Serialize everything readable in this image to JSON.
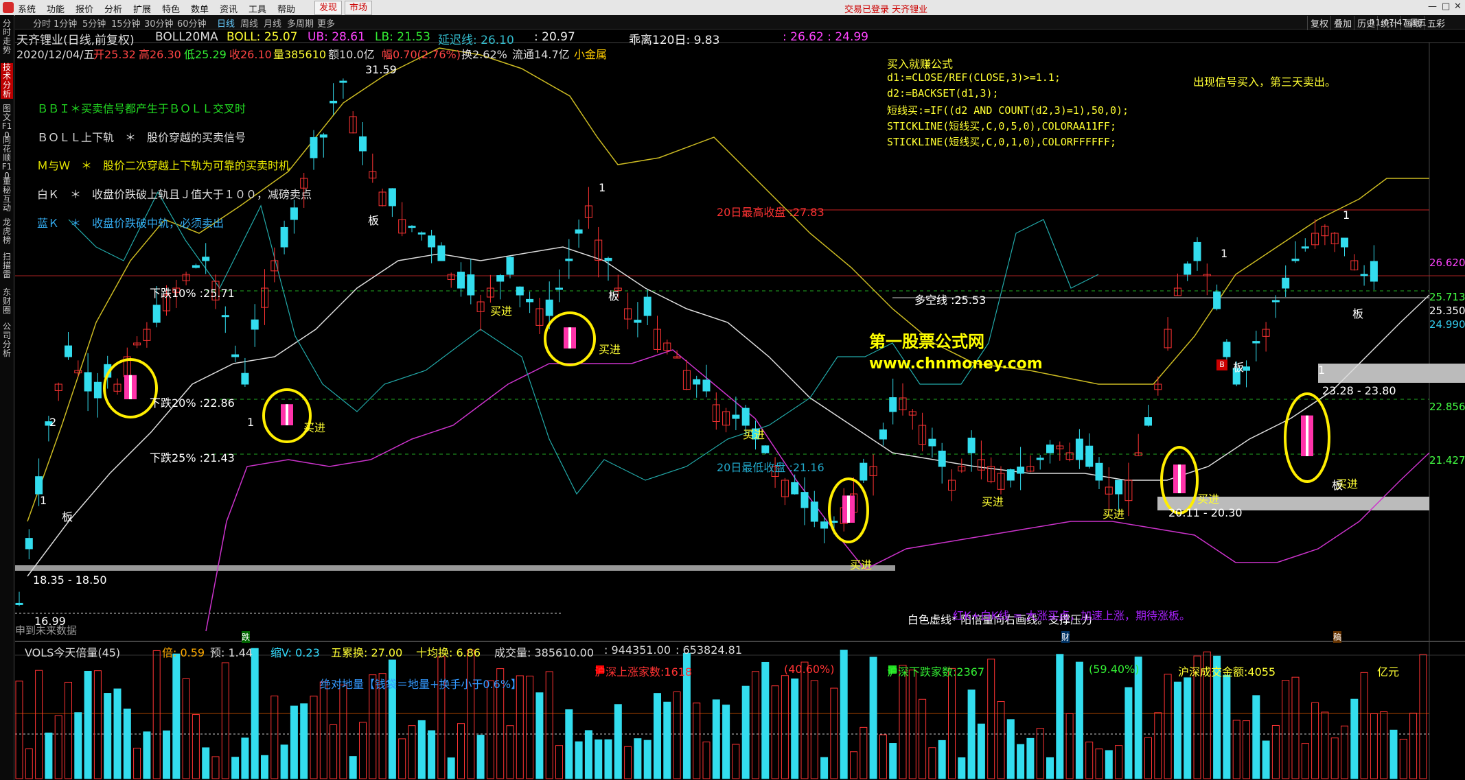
{
  "menu": {
    "items": [
      "系统",
      "功能",
      "报价",
      "分析",
      "扩展",
      "特色",
      "数单",
      "资讯",
      "工具",
      "帮助"
    ],
    "tab_active": "发现",
    "tab_market": "市场",
    "notice": "交易已登录  天齐锂业"
  },
  "periods": [
    "分时",
    "1分钟",
    "5分钟",
    "15分钟",
    "30分钟",
    "60分钟",
    "日线",
    "周线",
    "月线",
    "多周期",
    "更多"
  ],
  "active_period": "日线",
  "right_toolbar": [
    "复权",
    "叠加",
    "历史",
    "统计",
    "画线",
    "五彩"
  ],
  "sidebar": [
    "分时走势",
    "技术分析",
    "图文F10",
    "同花顺F10",
    "董秘互动",
    "龙虎榜",
    "扫描雷",
    "东财圈",
    "公司分析"
  ],
  "header": {
    "stock": "天齐锂业(日线,前复权)",
    "indicator": "BOLL20MA",
    "boll": "BOLL: 25.07",
    "ub": "UB: 28.61",
    "lb": "LB: 21.53",
    "delay": "延迟线: 26.10",
    "val2097": ": 20.97",
    "deviation": "乖离120日: 9.83",
    "range": ": 26.62 : 24.99"
  },
  "quote": {
    "date": "2020/12/04/五",
    "open": "开25.32",
    "high": "高26.30",
    "low": "低25.29",
    "close": "收26.10",
    "volume": "量385610",
    "amount": "额10.0亿",
    "change": "幅0.70(2.76%)",
    "turnover": "换2.62%",
    "float": "流通14.7亿",
    "tag": "小金属"
  },
  "legend": [
    {
      "text": "ＢＢＩ＊买卖信号都产生于ＢＯＬＬ交叉时",
      "color": "#22dd22"
    },
    {
      "text": "ＢＯＬＬ上下轨　＊　股价穿越的买卖信号",
      "color": "#dddddd"
    },
    {
      "text": "Ｍ与Ｗ　＊　股价二次穿越上下轨为可靠的买卖时机",
      "color": "#eeee00"
    },
    {
      "text": "白Ｋ　＊　收盘价跌破上轨且Ｊ值大于１００，减磅卖点",
      "color": "#dddddd"
    },
    {
      "text": "蓝Ｋ　＊　收盘价跌破中轨，必须卖出",
      "color": "#33aaee"
    }
  ],
  "formula": {
    "title": "买入就赚公式",
    "lines": [
      "d1:=CLOSE/REF(CLOSE,3)>=1.1;",
      "d2:=BACKSET(d1,3);",
      "短线买:=IF((d2 AND COUNT(d2,3)=1),50,0);",
      "STICKLINE(短线买,C,0,5,0),COLORAA11FF;",
      "STICKLINE(短线买,C,0,1,0),COLORFFFFFF;"
    ],
    "note": "出现信号买入，第三天卖出。"
  },
  "watermark": {
    "cn": "第一股票公式网",
    "url": "www.chnmoney.com"
  },
  "annotations": {
    "high_price": "31.59",
    "low_price": "16.99",
    "range1": "18.35 - 18.50",
    "range2": "23.28 - 23.80",
    "range3": "20.11 - 20.30",
    "drop10": "下跌10% :25.71",
    "drop20": "下跌20% :22.86",
    "drop25": "下跌25% :21.43",
    "high20": "20日最高收盘 :27.83",
    "low20": "20日最低收盘 :21.16",
    "bull_bear": "多空线 :25.53",
    "buy": "买进",
    "board": "板",
    "bottom_note1": "白色虚线* 阳倍量向右画线。支撑压力",
    "bottom_note2": "红K+白K线 = 大涨买点，加速上涨，期待涨板。",
    "no_data": "申到未来数据",
    "n1": "1",
    "n2": "2",
    "label_die": "跌",
    "label_cai": "财",
    "label_gao": "稿"
  },
  "price_axis": {
    "p1": "26.620",
    "p2": "25.713",
    "p3": "25.350",
    "p4": "24.990",
    "p5": "22.856",
    "p6": "21.427"
  },
  "vol_header": {
    "name": "VOLS今天倍量(45)",
    "bei": "倍: 0.59",
    "yu": "预: 1.44",
    "suov": "缩V: 0.23",
    "wuli": "五累换: 27.00",
    "shijun": "十均换: 6.86",
    "volume": "成交量: 385610.00",
    "v2": ": 944351.00",
    "v3": ": 653824.81"
  },
  "vol_info": {
    "ground": "绝对地量【钱袋＝地量+换手小于0.6%】",
    "up_count": "沪深上涨家数:1618",
    "up_pct": "(40.60%)",
    "down_count": "沪深下跌家数:2367",
    "down_pct": "(59.40%)",
    "amount": "沪深成交金额:4055",
    "unit": "亿元"
  },
  "clock": "11:07:47 周五"
}
